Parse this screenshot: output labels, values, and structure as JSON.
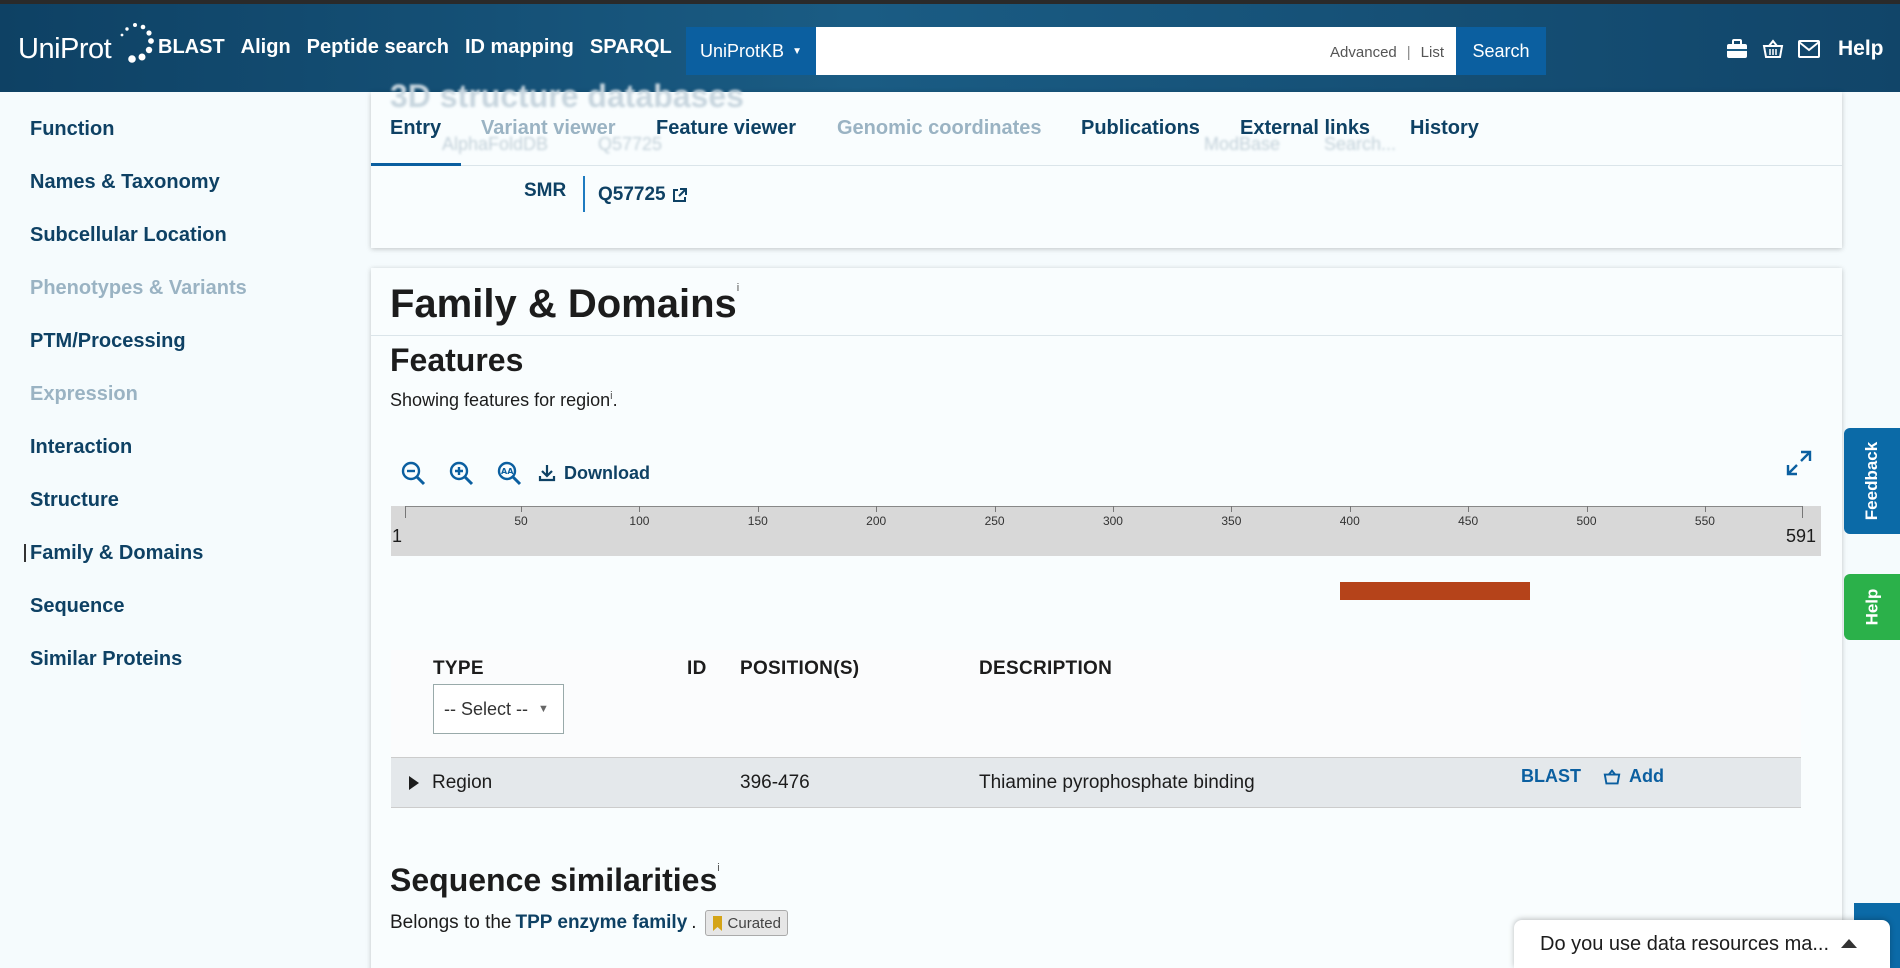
{
  "header": {
    "logo": "UniProt",
    "nav": [
      "BLAST",
      "Align",
      "Peptide search",
      "ID mapping",
      "SPARQL"
    ],
    "db_select": "UniProtKB",
    "search_value": "",
    "advanced": "Advanced",
    "list": "List",
    "search_button": "Search",
    "help": "Help"
  },
  "sidebar": {
    "items": [
      {
        "label": "Function",
        "state": "normal"
      },
      {
        "label": "Names & Taxonomy",
        "state": "normal"
      },
      {
        "label": "Subcellular Location",
        "state": "normal"
      },
      {
        "label": "Phenotypes & Variants",
        "state": "disabled"
      },
      {
        "label": "PTM/Processing",
        "state": "normal"
      },
      {
        "label": "Expression",
        "state": "disabled"
      },
      {
        "label": "Interaction",
        "state": "normal"
      },
      {
        "label": "Structure",
        "state": "normal"
      },
      {
        "label": "Family & Domains",
        "state": "active"
      },
      {
        "label": "Sequence",
        "state": "normal"
      },
      {
        "label": "Similar Proteins",
        "state": "normal"
      }
    ]
  },
  "ghost": {
    "title": "3D structure databases",
    "row": [
      "AlphaFoldDB",
      "Q57725",
      "ModBase",
      "Search..."
    ]
  },
  "tabs": [
    {
      "label": "Entry",
      "state": "active"
    },
    {
      "label": "Variant viewer",
      "state": "disabled"
    },
    {
      "label": "Feature viewer",
      "state": "normal"
    },
    {
      "label": "Genomic coordinates",
      "state": "disabled"
    },
    {
      "label": "Publications",
      "state": "normal"
    },
    {
      "label": "External links",
      "state": "normal"
    },
    {
      "label": "History",
      "state": "normal"
    }
  ],
  "smr": {
    "label": "SMR",
    "link": "Q57725"
  },
  "family": {
    "title": "Family & Domains",
    "info": "i",
    "features_title": "Features",
    "showing_pre": "Showing features for region",
    "showing_post": ".",
    "download": "Download"
  },
  "ruler": {
    "start": "1",
    "end": "591",
    "length": 591,
    "ticks": [
      50,
      100,
      150,
      200,
      250,
      300,
      350,
      400,
      450,
      500,
      550
    ]
  },
  "track": {
    "start": 396,
    "end": 476,
    "color": "#b5431a"
  },
  "table": {
    "headers": {
      "type": "TYPE",
      "id": "ID",
      "positions": "POSITION(S)",
      "description": "DESCRIPTION"
    },
    "select_placeholder": "-- Select --",
    "rows": [
      {
        "type": "Region",
        "id": "",
        "positions": "396-476",
        "description": "Thiamine pyrophosphate binding",
        "blast": "BLAST",
        "add": "Add"
      }
    ]
  },
  "similarities": {
    "title": "Sequence similarities",
    "pre": "Belongs to the",
    "link": "TPP enzyme family",
    "post": ".",
    "badge": "Curated"
  },
  "sidetabs": {
    "feedback": "Feedback",
    "help": "Help"
  },
  "survey": {
    "text": "Do you use data resources ma..."
  },
  "colors": {
    "header_bg": "#0e4164",
    "accent": "#0b5fa0",
    "feature": "#b5431a",
    "help_green": "#2bb14a"
  }
}
